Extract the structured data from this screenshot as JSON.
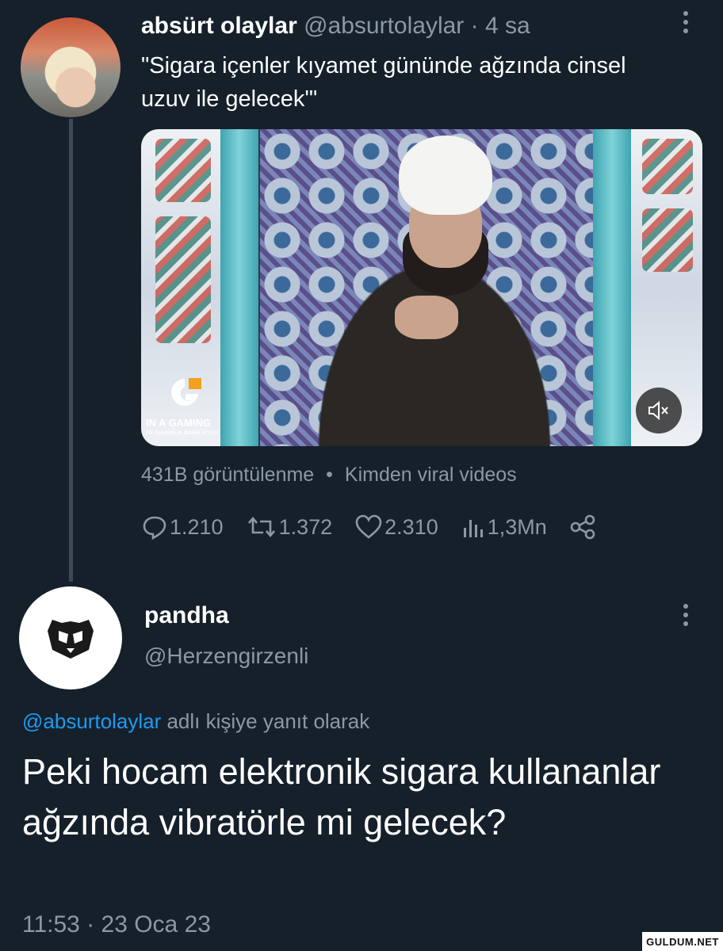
{
  "tweet1": {
    "name": "absürt olaylar",
    "handle": "@absurtolaylar",
    "time": "· 4 sa",
    "text": "\"Sigara içenler kıyamet gününde ağzında cinsel uzuv ile gelecek'\"",
    "media": {
      "overlay_logo_text": "IN A GAMING",
      "overlay_logo_subtext": "EN GÜVENİLİR BAHİS SİTESİ"
    },
    "views_line": {
      "views": "431B görüntülenme",
      "separator": "•",
      "source": "Kimden viral videos"
    },
    "actions": {
      "replies": "1.210",
      "retweets": "1.372",
      "likes": "2.310",
      "impressions": "1,3Mn"
    }
  },
  "tweet2": {
    "name": "pandha",
    "handle": "@Herzengirzenli",
    "reply_mention": "@absurtolaylar",
    "reply_suffix": " adlı kişiye yanıt olarak",
    "text": "Peki hocam elektronik sigara kullananlar ağzında vibratörle mi gelecek?",
    "timestamp": "11:53 · 23 Oca 23"
  },
  "watermark": "GULDUM.NET",
  "colors": {
    "background": "#15202b",
    "secondary_text": "#8b98a5",
    "link": "#1d9bf0",
    "thread_line": "#3d4a56"
  },
  "icons": [
    "more-icon",
    "reply-icon",
    "retweet-icon",
    "like-icon",
    "views-icon",
    "share-icon",
    "mute-icon",
    "panda-icon"
  ]
}
